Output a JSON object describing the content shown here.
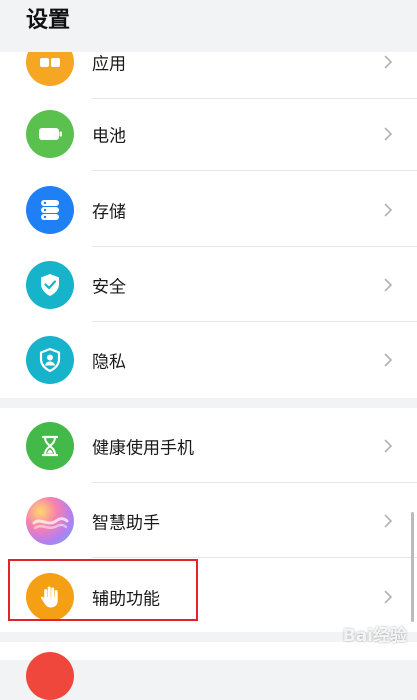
{
  "header": {
    "title": "设置"
  },
  "items": [
    {
      "label": "应用",
      "icon": "apps-icon",
      "color": "#f5a623"
    },
    {
      "label": "电池",
      "icon": "battery-icon",
      "color": "#5ac14f"
    },
    {
      "label": "存储",
      "icon": "storage-icon",
      "color": "#1f7ff5"
    },
    {
      "label": "安全",
      "icon": "shield-check-icon",
      "color": "#17b3ca"
    },
    {
      "label": "隐私",
      "icon": "privacy-icon",
      "color": "#17b3ca"
    },
    {
      "label": "健康使用手机",
      "icon": "hourglass-icon",
      "color": "#43b94a"
    },
    {
      "label": "智慧助手",
      "icon": "assistant-icon",
      "color": "#c37be6"
    },
    {
      "label": "辅助功能",
      "icon": "hand-icon",
      "color": "#f5a014"
    }
  ],
  "watermark": "Bai经验"
}
